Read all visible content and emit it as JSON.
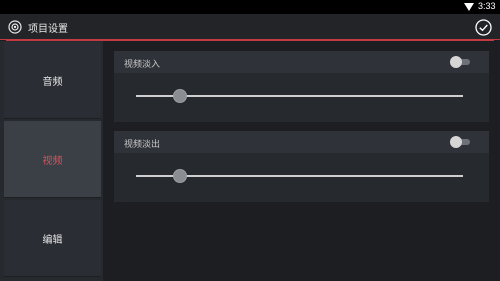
{
  "status_bar": {
    "time": "3:33",
    "wifi_icon": "wifi-icon"
  },
  "header": {
    "title": "项目设置",
    "back_icon": "back-circle-icon",
    "confirm_icon": "checkmark-circle-icon"
  },
  "sidebar": {
    "items": [
      {
        "label": "音频",
        "active": false
      },
      {
        "label": "视频",
        "active": true
      },
      {
        "label": "编辑",
        "active": false
      }
    ]
  },
  "panels": [
    {
      "label": "视频淡入",
      "toggle_on": false,
      "slider_value": 0.14
    },
    {
      "label": "视频淡出",
      "toggle_on": false,
      "slider_value": 0.14
    }
  ],
  "colors": {
    "accent": "#c43a43",
    "active_text": "#d8505a"
  }
}
